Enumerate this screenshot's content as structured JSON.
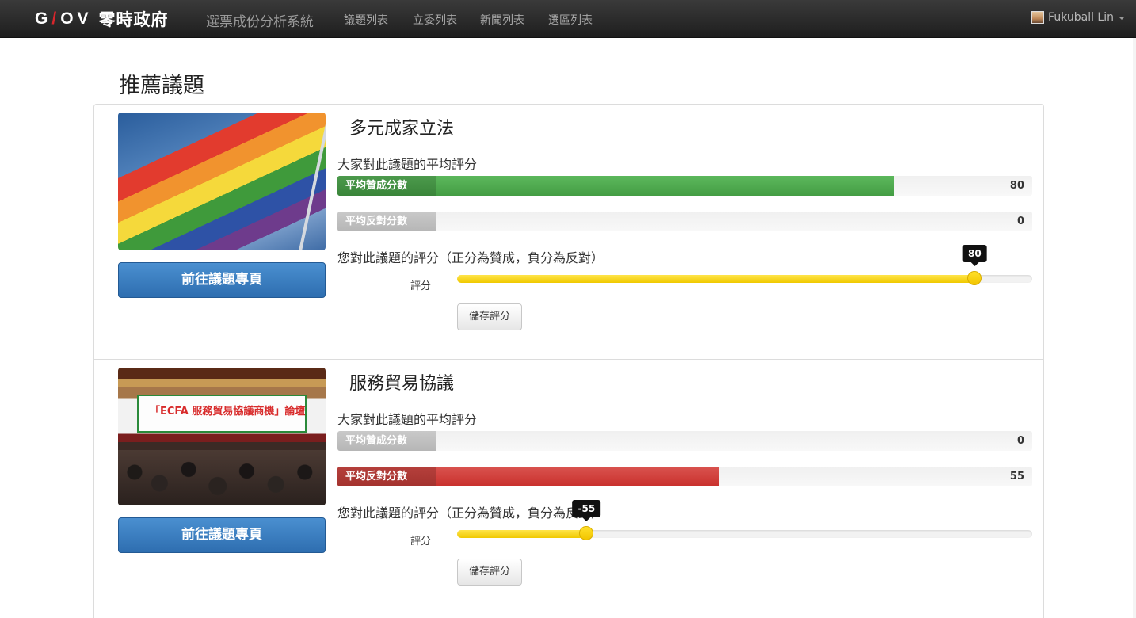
{
  "navbar": {
    "logo": "GOV",
    "brand": "零時政府",
    "title": "選票成份分析系統",
    "links": [
      "議題列表",
      "立委列表",
      "新聞列表",
      "選區列表"
    ],
    "user": "Fukuball Lin"
  },
  "page": {
    "heading": "推薦議題"
  },
  "issues": [
    {
      "title": "多元成家立法",
      "button": "前往議題專頁",
      "avg_heading": "大家對此議題的平均評分",
      "support": {
        "label": "平均贊成分數",
        "value": "80",
        "fraction": 0.8
      },
      "oppose": {
        "label": "平均反對分數",
        "value": "0",
        "fraction": 0.0
      },
      "your_heading": "您對此議題的評分（正分為贊成，負分為反對）",
      "score_label": "評分",
      "score": "80",
      "score_fraction": 0.9,
      "save": "儲存評分"
    },
    {
      "title": "服務貿易協議",
      "button": "前往議題專頁",
      "avg_heading": "大家對此議題的平均評分",
      "image_text": "「ECFA 服務貿易協議商機」論壇",
      "support": {
        "label": "平均贊成分數",
        "value": "0",
        "fraction": 0.0
      },
      "oppose": {
        "label": "平均反對分數",
        "value": "55",
        "fraction": 0.55
      },
      "your_heading": "您對此議題的評分（正分為贊成，負分為反對）",
      "score_label": "評分",
      "score": "-55",
      "score_fraction": 0.225,
      "save": "儲存評分"
    }
  ],
  "colors": {
    "support": "#5cb85c",
    "oppose": "#d9534f",
    "slider": "#f5d400",
    "primary": "#337ab7"
  }
}
